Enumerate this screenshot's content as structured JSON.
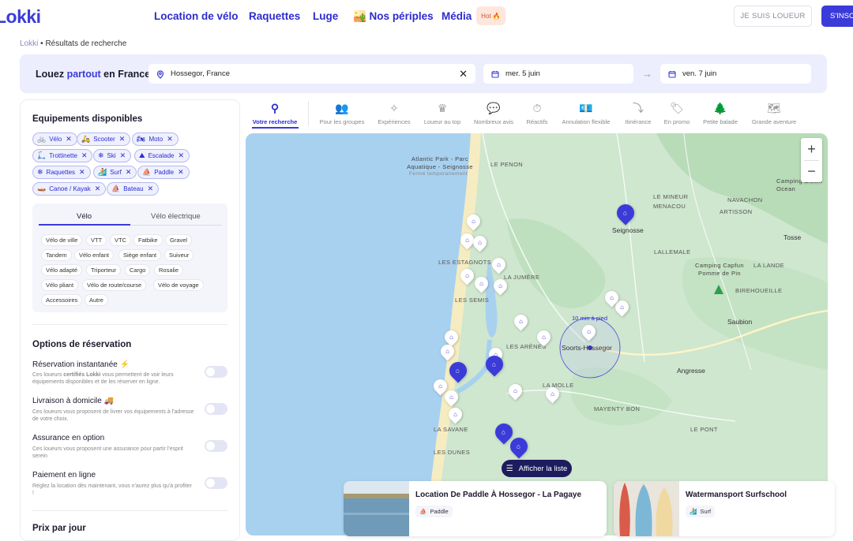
{
  "header": {
    "logo": "Lokki",
    "nav": [
      "Location de vélo",
      "Raquettes",
      "Luge",
      "🏜️ Nos périples",
      "Média"
    ],
    "hot_badge": "Hot 🔥",
    "loueur_button": "JE SUIS LOUEUR",
    "signup_button": "S'INSC"
  },
  "breadcrumb": {
    "root": "Lokki",
    "sep": "•",
    "current": "Résultats de recherche"
  },
  "search": {
    "title_before": "Louez ",
    "title_accent": "partout",
    "title_after": " en France",
    "location_value": "Hossegor, France",
    "clear_icon": "✕",
    "date_start": "mer. 5 juin",
    "date_end": "ven. 7 juin",
    "arrow": "→"
  },
  "sidebar": {
    "equip_title": "Equipements disponibles",
    "chips": [
      {
        "icon": "🚲",
        "label": "Vélo"
      },
      {
        "icon": "🛵",
        "label": "Scooter"
      },
      {
        "icon": "🏍",
        "label": "Moto"
      },
      {
        "icon": "🛴",
        "label": "Trottinette"
      },
      {
        "icon": "❄",
        "label": "Ski"
      },
      {
        "icon": "⛰",
        "label": "Escalade"
      },
      {
        "icon": "❄",
        "label": "Raquettes"
      },
      {
        "icon": "🏄",
        "label": "Surf"
      },
      {
        "icon": "⛵",
        "label": "Paddle"
      },
      {
        "icon": "🛶",
        "label": "Canoe / Kayak"
      },
      {
        "icon": "⛵",
        "label": "Bateau"
      }
    ],
    "tabs": [
      "Vélo",
      "Vélo électrique"
    ],
    "subchips": [
      "Vélo de ville",
      "VTT",
      "VTC",
      "Fatbike",
      "Gravel",
      "Tandem",
      "Vélo enfant",
      "Siège enfant",
      "Suiveur",
      "Vélo adapté",
      "Triporteur",
      "Cargo",
      "Rosalie",
      "Vélo pliant",
      "Vélo de route/course",
      "Vélo de voyage",
      "Accessoires",
      "Autre"
    ],
    "options_title": "Options de réservation",
    "options": [
      {
        "title": "Réservation instantanée ⚡",
        "desc_before": "Ces loueurs ",
        "desc_bold": "certifiés Lokki",
        "desc_after": " vous permettent de voir leurs équipements disponibles et de les réserver en ligne."
      },
      {
        "title": "Livraison à domicile 🚚",
        "desc_before": "Ces loueurs vous proposent de livrer vos équipements à l'adresse de votre choix.",
        "desc_bold": "",
        "desc_after": ""
      },
      {
        "title": "Assurance en option",
        "desc_before": "Ces loueurs vous proposent une assurance pour partir l'esprit serein",
        "desc_bold": "",
        "desc_after": ""
      },
      {
        "title": "Paiement en ligne",
        "desc_before": "Réglez la location dès maintenant, vous n'aurez plus qu'à profiter !",
        "desc_bold": "",
        "desc_after": ""
      }
    ],
    "price_title": "Prix par jour"
  },
  "filter_tabs": [
    {
      "icon": "⚲",
      "label": "Votre recherche"
    },
    {
      "icon": "👥",
      "label": "Pour les groupes"
    },
    {
      "icon": "✧",
      "label": "Expériences"
    },
    {
      "icon": "♛",
      "label": "Loueur au top"
    },
    {
      "icon": "💬",
      "label": "Nombreux avis"
    },
    {
      "icon": "⏱",
      "label": "Réactifs"
    },
    {
      "icon": "💶",
      "label": "Annulation flexible"
    },
    {
      "icon": "⤵",
      "label": "Itinérance"
    },
    {
      "icon": "🏷",
      "label": "En promo"
    },
    {
      "icon": "🌲",
      "label": "Petite balade"
    },
    {
      "icon": "🗺",
      "label": "Grande aventure"
    }
  ],
  "map": {
    "labels": {
      "atlantic": "Atlantic Park - Parc Aquatique - Seignosse",
      "atlantic_status": "Fermé temporairement",
      "penon": "LE PENON",
      "mineur": "LE MINEUR",
      "menacou": "MENACOU",
      "navachon": "NAVACHON",
      "artisson": "ARTISSON",
      "camping1": "Camping Clown Ocean",
      "seignosse": "Seignosse",
      "tosse": "Tosse",
      "estagnot": "LES ESTAGNOTS",
      "jumere": "LA JUMÈRE",
      "lallemale": "LALLEMALE",
      "lalande": "LA LANDE",
      "camping2": "Camping Capfun Pomme de Pin",
      "birehoueille": "BIREHOUEILLE",
      "semis": "LES SEMIS",
      "saubion": "Saubion",
      "arenes": "LES ARÈNES",
      "soorts": "Soorts-Hossegor",
      "ten_min": "10 min à pied",
      "angresse": "Angresse",
      "mole": "LA MOLLE",
      "mayenty": "MAYENTY BON",
      "savane": "LA SAVANE",
      "pont": "LE PONT",
      "dunes": "LES DUNES"
    },
    "zoom_in": "+",
    "zoom_out": "−",
    "list_button": "Afficher la liste",
    "list_icon": "☰"
  },
  "cards": [
    {
      "title": "Location De Paddle À Hossegor - La Pagaye",
      "tag_icon": "⛵",
      "tag": "Paddle"
    },
    {
      "title": "Watermansport Surfschool",
      "tag_icon": "🏄",
      "tag": "Surf"
    }
  ],
  "colors": {
    "brand": "#3b3bd9",
    "navy": "#1c1c5e",
    "ocean": "#a8d1f0",
    "land": "#cfe6cf",
    "beach": "#f6ecc2",
    "forest": "#b8dbb8"
  }
}
